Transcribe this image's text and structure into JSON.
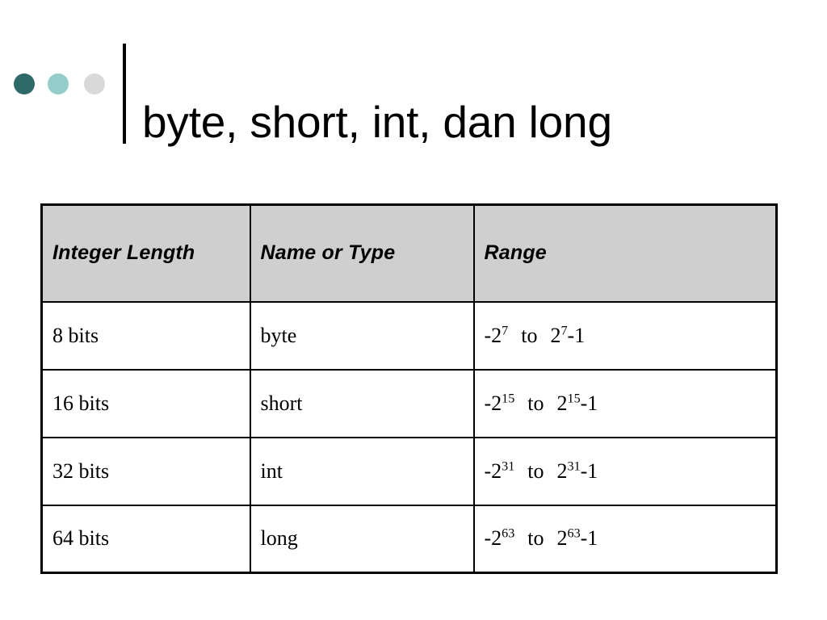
{
  "slide": {
    "title": "byte, short, int, dan long",
    "decor_dots": [
      {
        "name": "dot-dark-teal",
        "color": "#2e6b68"
      },
      {
        "name": "dot-light-teal",
        "color": "#93cccb"
      },
      {
        "name": "dot-light-gray",
        "color": "#d9d9d9"
      }
    ],
    "divider_color": "#000000"
  },
  "table": {
    "header_background": "#cfcfcf",
    "border_color": "#000000",
    "columns": [
      "Integer Length",
      "Name or Type",
      "Range"
    ],
    "rows": [
      {
        "integer_length": "8 bits",
        "name_or_type": "byte",
        "range_negative_base": "-2",
        "range_negative_exponent": "7",
        "range_separator": "to",
        "range_positive_base": "2",
        "range_positive_exponent": "7",
        "range_positive_suffix": "-1",
        "range_text": "-2^7 to 2^7-1"
      },
      {
        "integer_length": "16 bits",
        "name_or_type": "short",
        "range_negative_base": "-2",
        "range_negative_exponent": "15",
        "range_separator": "to",
        "range_positive_base": "2",
        "range_positive_exponent": "15",
        "range_positive_suffix": "-1",
        "range_text": "-2^15 to 2^15-1"
      },
      {
        "integer_length": "32 bits",
        "name_or_type": "int",
        "range_negative_base": "-2",
        "range_negative_exponent": "31",
        "range_separator": "to",
        "range_positive_base": "2",
        "range_positive_exponent": "31",
        "range_positive_suffix": "-1",
        "range_text": "-2^31 to 2^31-1"
      },
      {
        "integer_length": "64 bits",
        "name_or_type": "long",
        "range_negative_base": "-2",
        "range_negative_exponent": "63",
        "range_separator": "to",
        "range_positive_base": "2",
        "range_positive_exponent": "63",
        "range_positive_suffix": "-1",
        "range_text": "-2^63 to 2^63-1"
      }
    ]
  }
}
